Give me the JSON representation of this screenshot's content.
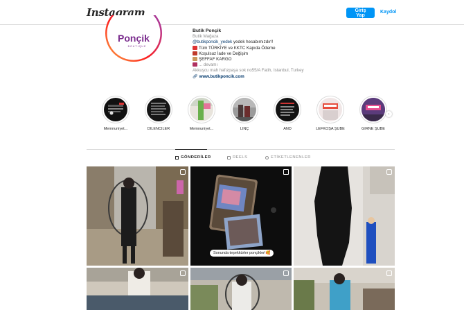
{
  "header": {
    "logo": "Instagram",
    "login_label": "Giriş Yap",
    "signup_label": "Kaydol"
  },
  "profile": {
    "avatar_brand": "Ponçik",
    "avatar_sub": "BOUTIQUE",
    "name": "Butik Ponçik",
    "category": "Butik Mağaza",
    "mention": "@butikponcik_yedek",
    "mention_suffix": " yedek hesabımızdır!!",
    "line3": "Tüm TÜRKİYE ve KKTC Kapıda Ödeme",
    "line4": "Koşulsuz İade ve Değişim",
    "line5": "ŞEFFAF KARGO",
    "more": "... devamı",
    "address": "Akkuşcu mah hafızpaşa sok no55/A Fatih, Istanbul, Turkey",
    "link": "www.butikponcik.com"
  },
  "highlights": [
    {
      "label": "Memnuniyet..."
    },
    {
      "label": "DİLENCİLER"
    },
    {
      "label": "Memnuniyet..."
    },
    {
      "label": "LİNÇ"
    },
    {
      "label": "AND"
    },
    {
      "label": "LEFKOŞA ŞUBE"
    },
    {
      "label": "GİRNE ŞUBE"
    }
  ],
  "tabs": {
    "posts": "GÖNDERİLER",
    "reels": "REELS",
    "tagged": "ETİKETLENENLER"
  },
  "posts": {
    "reel_caption": "Sonunda teşekkürler ponçikler!🥰"
  },
  "colors": {
    "accent": "#0095f6",
    "brand_purple": "#7b2d8e"
  }
}
